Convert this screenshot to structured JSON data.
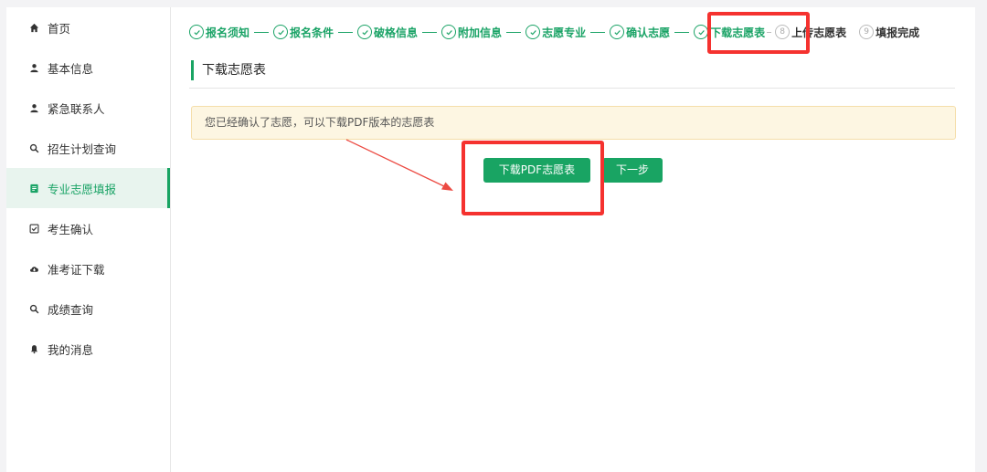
{
  "sidebar": {
    "items": [
      {
        "label": "首页",
        "icon": "home-icon"
      },
      {
        "label": "基本信息",
        "icon": "user-icon"
      },
      {
        "label": "紧急联系人",
        "icon": "user-icon"
      },
      {
        "label": "招生计划查询",
        "icon": "search-icon"
      },
      {
        "label": "专业志愿填报",
        "icon": "form-icon",
        "active": true
      },
      {
        "label": "考生确认",
        "icon": "checkbox-icon"
      },
      {
        "label": "准考证下载",
        "icon": "cloud-download-icon"
      },
      {
        "label": "成绩查询",
        "icon": "search-icon"
      },
      {
        "label": "我的消息",
        "icon": "bell-icon"
      }
    ]
  },
  "steps": [
    {
      "label": "报名须知",
      "status": "done"
    },
    {
      "label": "报名条件",
      "status": "done"
    },
    {
      "label": "破格信息",
      "status": "done"
    },
    {
      "label": "附加信息",
      "status": "done"
    },
    {
      "label": "志愿专业",
      "status": "done"
    },
    {
      "label": "确认志愿",
      "status": "done"
    },
    {
      "label": "下载志愿表",
      "status": "current"
    },
    {
      "label": "上传志愿表",
      "status": "pending",
      "number": "8"
    },
    {
      "label": "填报完成",
      "status": "pending",
      "number": "9"
    }
  ],
  "main": {
    "title": "下载志愿表",
    "notice": "您已经确认了志愿，可以下载PDF版本的志愿表",
    "download_button": "下载PDF志愿表",
    "next_button": "下一步"
  },
  "colors": {
    "accent": "#19a463",
    "highlight": "#f5322f",
    "notice_bg": "#fdf6e2"
  }
}
